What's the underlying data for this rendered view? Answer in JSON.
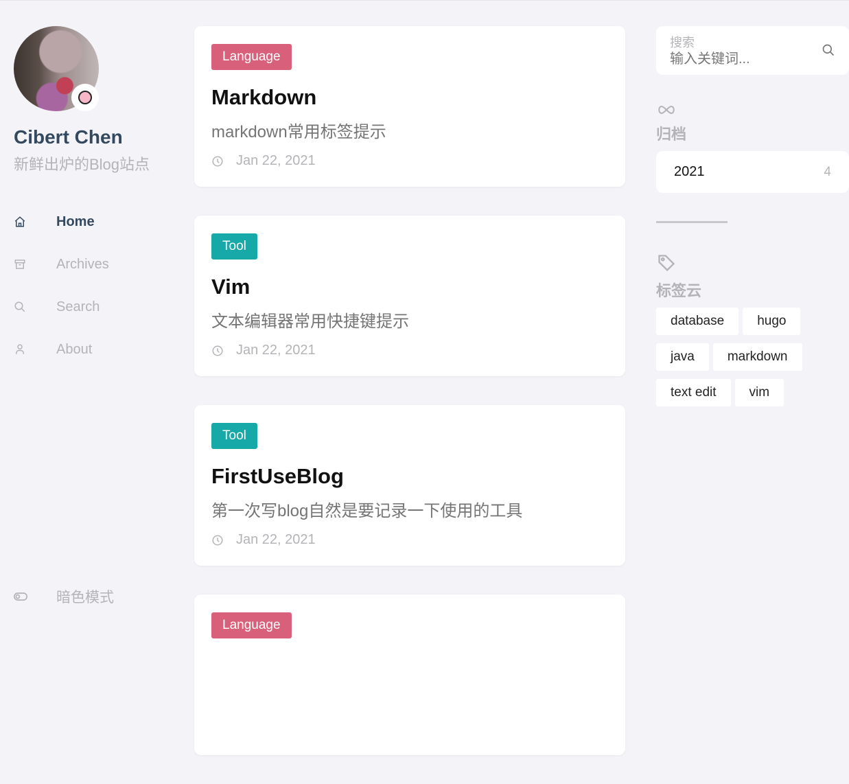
{
  "profile": {
    "name": "Cibert Chen",
    "description": "新鲜出炉的Blog站点",
    "avatar_icon": "profile-photo",
    "badge_icon": "emoji-badge-icon"
  },
  "menu": {
    "items": [
      {
        "label": "Home",
        "icon": "home-icon",
        "active": true
      },
      {
        "label": "Archives",
        "icon": "archive-icon"
      },
      {
        "label": "Search",
        "icon": "search-icon"
      },
      {
        "label": "About",
        "icon": "user-icon"
      }
    ],
    "dark_mode_label": "暗色模式"
  },
  "posts": [
    {
      "category": "Language",
      "category_color": "#d9607a",
      "title": "Markdown",
      "summary": "markdown常用标签提示",
      "date": "Jan 22, 2021"
    },
    {
      "category": "Tool",
      "category_color": "#17a8a8",
      "title": "Vim",
      "summary": "文本编辑器常用快捷键提示",
      "date": "Jan 22, 2021"
    },
    {
      "category": "Tool",
      "category_color": "#17a8a8",
      "title": "FirstUseBlog",
      "summary": "第一次写blog自然是要记录一下使用的工具",
      "date": "Jan 22, 2021"
    },
    {
      "category": "Language",
      "category_color": "#d9607a",
      "title": "",
      "summary": "",
      "date": ""
    }
  ],
  "search": {
    "label": "搜索",
    "placeholder": "输入关键词..."
  },
  "archives": {
    "title": "归档",
    "items": [
      {
        "year": "2021",
        "count": "4"
      }
    ]
  },
  "tags": {
    "title": "标签云",
    "items": [
      "database",
      "hugo",
      "java",
      "markdown",
      "text edit",
      "vim"
    ]
  }
}
